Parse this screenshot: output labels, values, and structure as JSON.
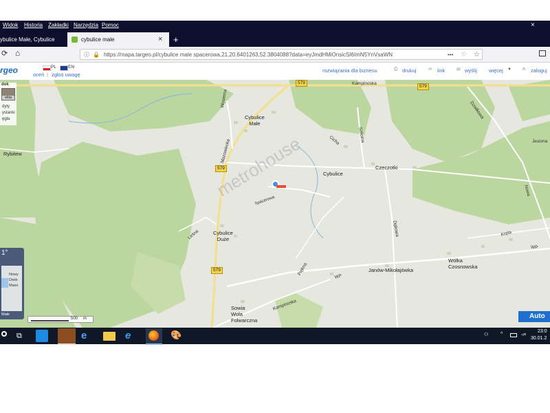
{
  "menu": {
    "items": [
      "Widok",
      "Historia",
      "Zakładki",
      "Narzędzia",
      "Pomoc"
    ]
  },
  "tabs": {
    "inactive": "ybulice Małe, Cybulice",
    "active": "cybulice male",
    "new_tab_symbol": "+",
    "close_symbol": "×"
  },
  "address": {
    "url": "https://mapa.targeo.pl/cybulice male spacerowa,21,20.6401263,52.3804088?data=eyJmdHMiOnsicSI6ImN5YnVsaWN",
    "more": "•••"
  },
  "site": {
    "logo": "rgeo",
    "lang_pl": "PL",
    "lang_en": "EN",
    "rate": "oceń",
    "separator": "|",
    "report": "zgłoś uwagę",
    "links": [
      "rozwiązania dla biznesu",
      "drukuj",
      "link",
      "wyślij",
      "więcej",
      "zaloguj"
    ]
  },
  "left_panel": {
    "title": "dok",
    "item": "elita",
    "line1": "dyty",
    "line2": "ystanki",
    "line3": "ęgla"
  },
  "minimap": {
    "temp": "1°",
    "place1": "Nowy",
    "place2": "Dwór",
    "place3": "Mazo",
    "label": "Małe"
  },
  "scale": {
    "value": "500",
    "unit": "m"
  },
  "map": {
    "places": {
      "cybulice_male_1": "Cybulice",
      "cybulice_male_2": "Małe",
      "rybitew": "Rybitew",
      "cybulice": "Cybulice",
      "czeczotki": "Czeczotki",
      "cybulice_duze_1": "Cybulice",
      "cybulice_duze_2": "Duże",
      "janow": "Janów-Mikołajówka",
      "wolka_1": "Wólka",
      "wolka_2": "Czosnowska",
      "sowia_1": "Sowia",
      "sowia_2": "Wola",
      "sowia_3": "Folwarczna"
    },
    "roads": {
      "kampinoska_top": "Kampinoska",
      "kampinoska_bottom": "Kampinoska",
      "wosiema": "Wosiema",
      "mazowiecka": "Mazowiecka",
      "cicha": "Cicha",
      "szkolna": "Szkolna",
      "dzialkowa": "Działkowa",
      "jesiona": "Jesiona",
      "nowa": "Nowa",
      "lesna": "Leśna",
      "spacerowa": "Spacerowa",
      "debowa": "Dębowa",
      "piekna": "Piękna",
      "kreta": "Kręta",
      "wp_right": "WP",
      "wp_mid": "WP"
    },
    "route_numbers": [
      "579",
      "579",
      "579",
      "579"
    ],
    "watermark": "metrohouse",
    "banner": "Auto"
  },
  "taskbar": {
    "time": "23:0",
    "date": "30.01.2"
  }
}
